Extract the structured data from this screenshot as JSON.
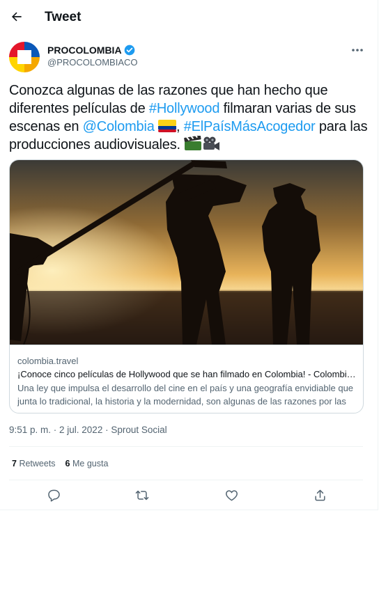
{
  "header": {
    "title": "Tweet"
  },
  "author": {
    "name": "PROCOLOMBIA",
    "handle": "@PROCOLOMBIACO"
  },
  "tweet": {
    "t1": "Conozca algunas de las razones que han hecho que diferentes películas de ",
    "hashtag1": "#Hollywood",
    "t2": " filmaran varias de sus escenas en ",
    "mention": "@Colombia",
    "t3": ", ",
    "hashtag2": "#ElPaísMásAcogedor",
    "t4": " para las producciones audiovisuales. "
  },
  "card": {
    "domain": "colombia.travel",
    "title": "¡Conoce cinco películas de Hollywood que se han filmado en Colombia! - Colombia Travel",
    "description": "Una ley que impulsa el desarrollo del cine en el país y una geografía envidiable que junta lo tradicional, la historia y la modernidad, son algunas de las razones por las que diferentes películas de Hollywood han filmado en Colombia."
  },
  "meta": {
    "timestamp": "9:51 p. m. · 2 jul. 2022",
    "separator": " · ",
    "source": "Sprout Social"
  },
  "stats": {
    "retweets_count": "7",
    "retweets_label": "Retweets",
    "likes_count": "6",
    "likes_label": "Me gusta"
  },
  "colors": {
    "accent": "#1d9bf0",
    "text": "#0f1419",
    "secondary": "#536471",
    "border": "#cfd9de"
  },
  "icons": [
    "back-arrow-icon",
    "verified-badge-icon",
    "more-icon",
    "colombia-flag-icon",
    "clapper-board-icon",
    "movie-camera-icon",
    "reply-icon",
    "retweet-icon",
    "like-icon",
    "share-icon"
  ]
}
